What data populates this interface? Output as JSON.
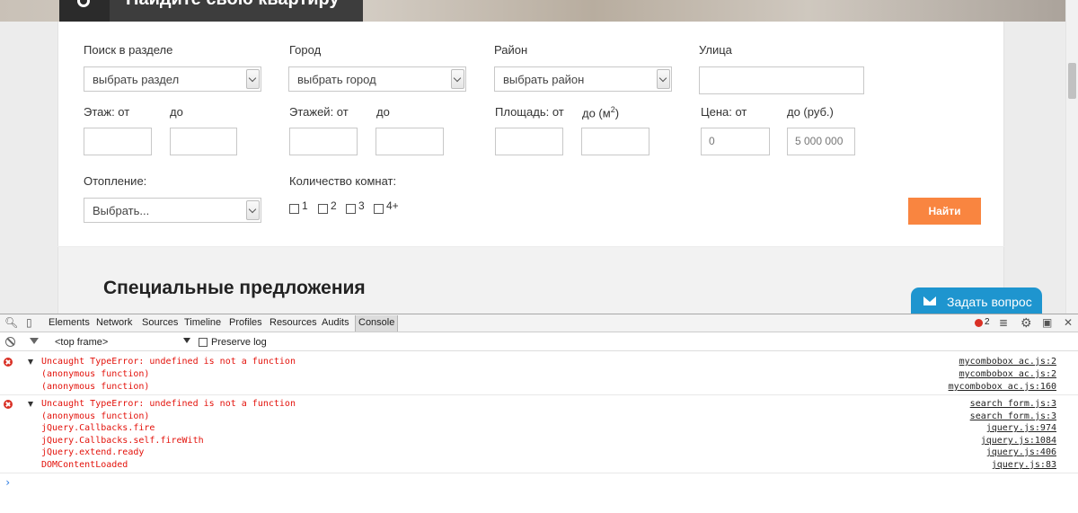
{
  "hero": {
    "title": "Найдите свою квартиру"
  },
  "search_form": {
    "section_label": "Поиск в разделе",
    "section_value": "выбрать раздел",
    "city_label": "Город",
    "city_value": "выбрать город",
    "district_label": "Район",
    "district_value": "выбрать район",
    "street_label": "Улица",
    "street_value": "",
    "floor_from_label": "Этаж: от",
    "floor_to_label": "до",
    "floors_from_label": "Этажей: от",
    "floors_to_label": "до",
    "area_from_label": "Площадь: от",
    "area_to_label": "до (м",
    "area_unit_sup": "2",
    "area_to_close": ")",
    "price_from_label": "Цена: от",
    "price_to_label": "до (руб.)",
    "price_from_value": "0",
    "price_to_value": "5 000 000",
    "heating_label": "Отопление:",
    "heating_value": "Выбрать...",
    "rooms_label": "Количество комнат:",
    "rooms": [
      "1",
      "2",
      "3",
      "4+"
    ],
    "find_button": "Найти"
  },
  "special": {
    "heading": "Специальные предложения"
  },
  "ask_button": "Задать вопрос",
  "colors": {
    "accent": "#f98540",
    "ask": "#1e95cf",
    "error": "#e3120b"
  },
  "devtools": {
    "tabs": [
      "Elements",
      "Network",
      "Sources",
      "Timeline",
      "Profiles",
      "Resources",
      "Audits",
      "Console"
    ],
    "error_count": "2",
    "frame": "<top frame>",
    "preserve_log": "Preserve log",
    "messages": [
      {
        "lines": [
          "Uncaught TypeError: undefined is not a function",
          "(anonymous function)",
          "(anonymous function)"
        ],
        "sources": [
          "mycombobox ac.js:2",
          "mycombobox ac.js:2",
          "mycombobox ac.js:160"
        ]
      },
      {
        "lines": [
          "Uncaught TypeError: undefined is not a function",
          "(anonymous function)",
          "jQuery.Callbacks.fire",
          "jQuery.Callbacks.self.fireWith",
          "jQuery.extend.ready",
          "DOMContentLoaded"
        ],
        "sources": [
          "search form.js:3",
          "search form.js:3",
          "jquery.js:974",
          "jquery.js:1084",
          "jquery.js:406",
          "jquery.js:83"
        ]
      }
    ],
    "prompt": "›"
  }
}
